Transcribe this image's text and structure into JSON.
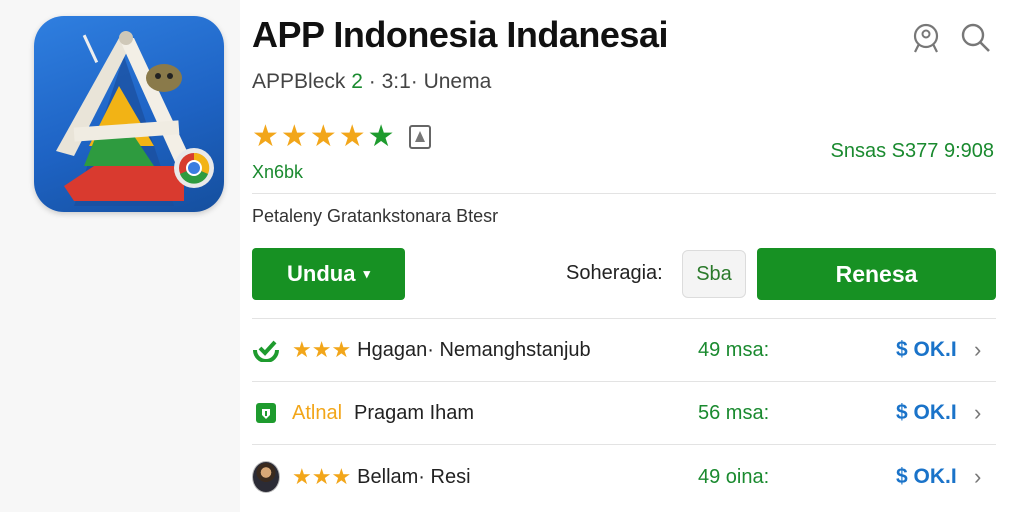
{
  "app": {
    "title": "APP Indonesia Indanesai",
    "subtitle_prefix": "APPBleck ",
    "subtitle_version": "2",
    "subtitle_suffix": " · 3:1· Unema",
    "rating_sub": "Xn6bk",
    "price_info": "Snsas S377 9:908",
    "description": "Petaleny Gratankstonara Btesr"
  },
  "header_icons": [
    {
      "name": "account-icon"
    },
    {
      "name": "search-icon"
    }
  ],
  "rating": {
    "gold_stars": 4,
    "green_stars": 1,
    "star_glyph": "★"
  },
  "actions": {
    "download_label": "Undua",
    "caret": "▾",
    "inline_label": "Soheragia:",
    "small_button": "Sba",
    "primary_label": "Renesa"
  },
  "list": [
    {
      "lead_icon": "check-logo-icon",
      "stars": "★★★",
      "badge": "",
      "name": "Hgagan· Nemanghstanjub",
      "size": "49 msa:",
      "price": "$ OK.I",
      "chevron": "›"
    },
    {
      "lead_icon": "shield-app-icon",
      "stars": "",
      "badge": "Atlnal",
      "name": "Pragam Iham",
      "size": "56 msa:",
      "price": "$ OK.I",
      "chevron": "›"
    },
    {
      "lead_icon": "avatar",
      "stars": "★★★",
      "badge": "",
      "name": "Bellam· Resi",
      "size": "49 oina:",
      "price": "$ OK.I",
      "chevron": "›"
    }
  ],
  "colors": {
    "accent_green": "#179123",
    "text_green": "#1a8a2f",
    "star_gold": "#f2a61a",
    "price_blue": "#1a73c9",
    "icon_blue": "#1e63c4"
  }
}
